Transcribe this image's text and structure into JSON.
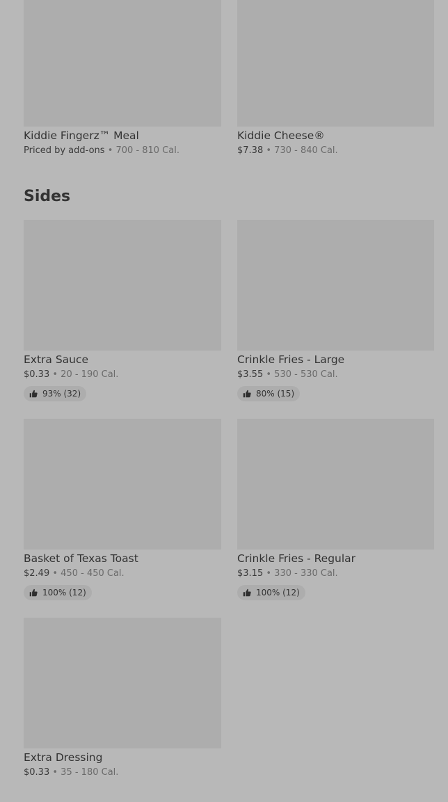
{
  "top_items": [
    {
      "name": "Kiddie Fingerz™ Meal",
      "price": "Priced by add-ons",
      "calories": "700 - 810 Cal."
    },
    {
      "name": "Kiddie Cheese®",
      "price": "$7.38",
      "calories": "730 - 840 Cal."
    }
  ],
  "sides": {
    "title": "Sides",
    "items": [
      {
        "name": "Extra Sauce",
        "price": "$0.33",
        "calories": "20 - 190 Cal.",
        "rating": "93% (32)"
      },
      {
        "name": "Crinkle Fries - Large",
        "price": "$3.55",
        "calories": "530 - 530 Cal.",
        "rating": "80% (15)"
      },
      {
        "name": "Basket of Texas Toast",
        "price": "$2.49",
        "calories": "450 - 450 Cal.",
        "rating": "100% (12)"
      },
      {
        "name": "Crinkle Fries - Regular",
        "price": "$3.15",
        "calories": "330 - 330 Cal.",
        "rating": "100% (12)"
      },
      {
        "name": "Extra Dressing",
        "price": "$0.33",
        "calories": "35 - 180 Cal."
      }
    ]
  },
  "separator": "•",
  "icons": {
    "rating": "thumbs-up-icon"
  },
  "colors": {
    "background": "#b8b8b8",
    "image_placeholder": "#adadad"
  }
}
